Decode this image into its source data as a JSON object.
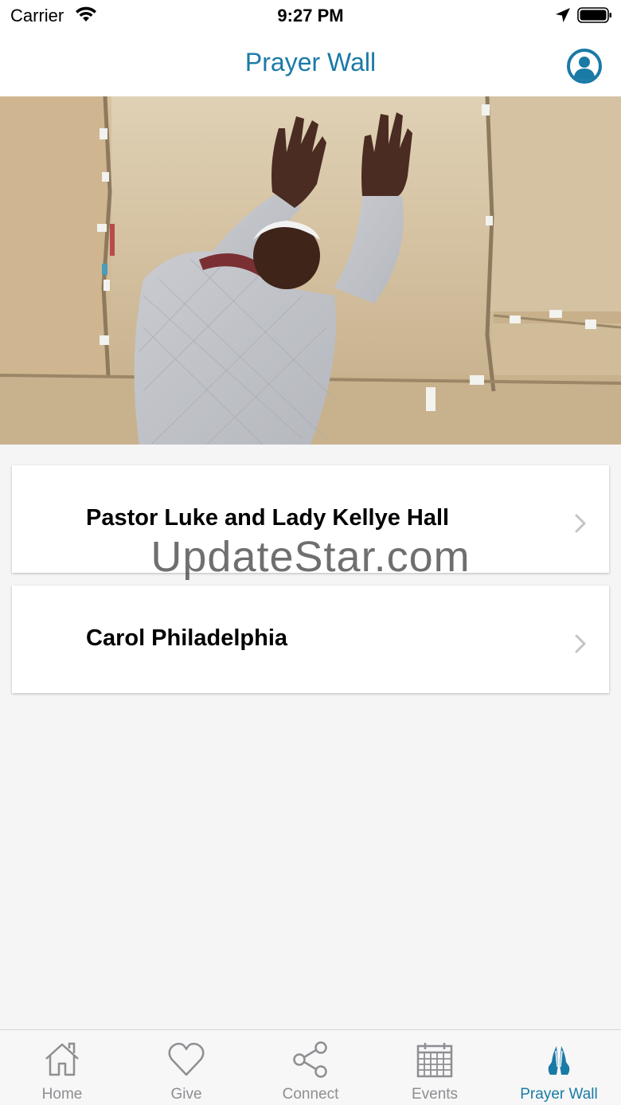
{
  "status_bar": {
    "carrier": "Carrier",
    "time": "9:27 PM"
  },
  "nav": {
    "title": "Prayer Wall",
    "profile_icon": "user-circle-icon"
  },
  "hero": {
    "icon": "praying-at-wall-photo"
  },
  "items": [
    {
      "title": "Pastor Luke and Lady Kellye Hall"
    },
    {
      "title": "Carol Philadelphia"
    }
  ],
  "watermark": "UpdateStar.com",
  "tabs": [
    {
      "label": "Home",
      "icon": "home-icon",
      "active": false
    },
    {
      "label": "Give",
      "icon": "heart-icon",
      "active": false
    },
    {
      "label": "Connect",
      "icon": "share-icon",
      "active": false
    },
    {
      "label": "Events",
      "icon": "calendar-icon",
      "active": false
    },
    {
      "label": "Prayer Wall",
      "icon": "praying-hands-icon",
      "active": true
    }
  ],
  "colors": {
    "accent": "#1a7aa6",
    "inactive": "#8e8e93",
    "background": "#f5f5f5"
  }
}
